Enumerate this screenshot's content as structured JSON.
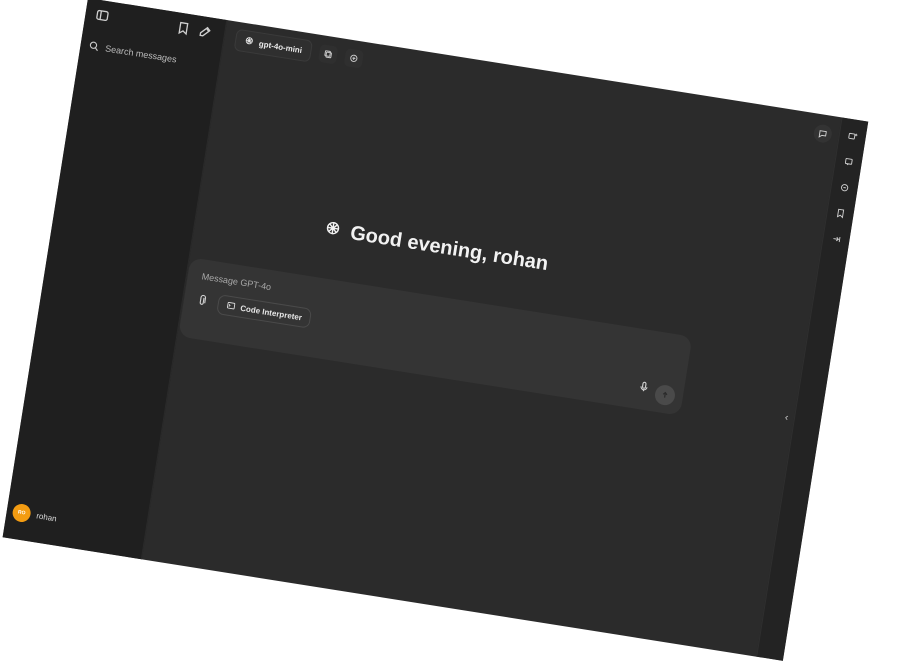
{
  "sidebar": {
    "search_placeholder": "Search messages",
    "user": {
      "name": "rohan",
      "avatar_initials": "RO"
    }
  },
  "topbar": {
    "model_label": "gpt-4o-mini"
  },
  "main": {
    "greeting": "Good evening, rohan",
    "composer": {
      "placeholder": "Message GPT-4o",
      "code_interpreter_label": "Code Interpreter"
    }
  },
  "icons": {
    "sidebar_toggle": "sidebar-toggle-icon",
    "bookmark": "bookmark-icon",
    "new_chat": "new-chat-icon",
    "search": "search-icon",
    "model": "openai-icon",
    "copy": "copy-icon",
    "add": "add-icon",
    "chat": "chat-icon",
    "controls": "controls-icon",
    "comment": "comment-icon",
    "link": "link-icon",
    "bookmark_rail": "bookmark-rail-icon",
    "collapse_right": "collapse-right-icon",
    "attach": "paperclip-icon",
    "mic": "microphone-icon",
    "send": "send-icon"
  },
  "colors": {
    "avatar": "#f39c12",
    "background": "#2b2b2b",
    "sidebar": "#1f1f1f"
  }
}
